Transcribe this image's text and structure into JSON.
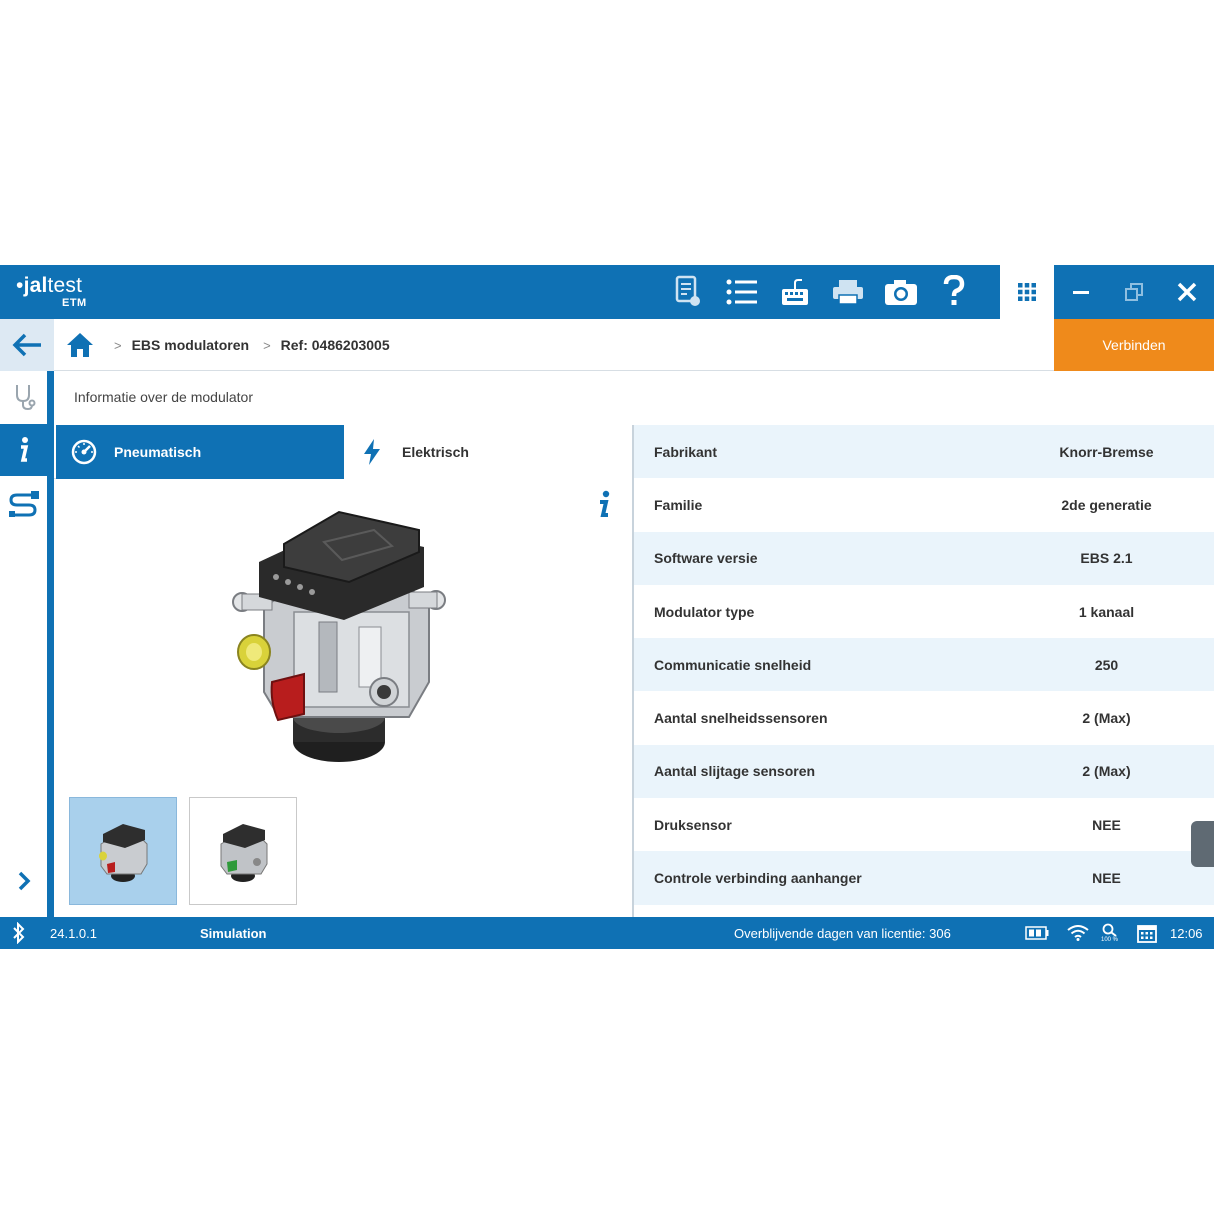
{
  "titlebar": {
    "brand_prefix": "•",
    "brand_bold": "jal",
    "brand_light": "test",
    "brand_sub": "ETM",
    "icons": [
      "report-icon",
      "list-icon",
      "keyboard-icon",
      "printer-icon",
      "camera-icon",
      "help-icon"
    ],
    "apps_icon": "grid-apps-icon",
    "window_controls": [
      "minimize-icon",
      "restore-icon",
      "close-icon"
    ]
  },
  "breadcrumb": {
    "items": [
      "EBS modulatoren",
      "Ref: 0486203005"
    ],
    "separator": ">"
  },
  "connect_label": "Verbinden",
  "section_title": "Informatie over de modulator",
  "tabs": [
    {
      "label": "Pneumatisch",
      "icon": "gauge-icon",
      "active": true
    },
    {
      "label": "Elektrisch",
      "icon": "lightning-icon",
      "active": false
    }
  ],
  "specs": [
    {
      "key": "Fabrikant",
      "value": "Knorr-Bremse"
    },
    {
      "key": "Familie",
      "value": "2de generatie"
    },
    {
      "key": "Software versie",
      "value": "EBS 2.1"
    },
    {
      "key": "Modulator type",
      "value": "1 kanaal"
    },
    {
      "key": "Communicatie snelheid",
      "value": "250"
    },
    {
      "key": "Aantal snelheidssensoren",
      "value": "2 (Max)"
    },
    {
      "key": "Aantal slijtage sensoren",
      "value": "2 (Max)"
    },
    {
      "key": "Druksensor",
      "value": "NEE"
    },
    {
      "key": "Controle verbinding aanhanger",
      "value": "NEE"
    }
  ],
  "statusbar": {
    "version": "24.1.0.1",
    "mode": "Simulation",
    "license": "Overblijvende dagen van licentie: 306",
    "zoom": "100 %",
    "time": "12:06"
  },
  "colors": {
    "primary": "#0f71b4",
    "accent": "#ef8a1b",
    "row_alt": "#eaf4fb"
  }
}
